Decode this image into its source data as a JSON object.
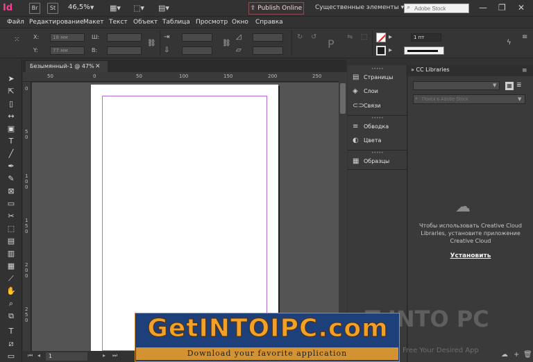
{
  "app": {
    "logo": "Id"
  },
  "titlebar": {
    "br_label": "Br",
    "st_label": "St",
    "zoom": "46,5%",
    "publish": "Publish Online",
    "workspace": "Существенные элементы",
    "stock_placeholder": "Adobe Stock"
  },
  "menu": [
    "Файл",
    "Редактирование",
    "Макет",
    "Текст",
    "Объект",
    "Таблица",
    "Просмотр",
    "Окно",
    "Справка"
  ],
  "control": {
    "x_label": "X:",
    "y_label": "Y:",
    "w_label": "Ш:",
    "h_label": "В:",
    "x_value": "18 мм",
    "y_value": "77 мм",
    "stroke_weight": "1 пт"
  },
  "document": {
    "tab_title": "Безымянный-1 @ 47%",
    "page_number": "1",
    "ruler_top": [
      "50",
      "0",
      "50",
      "100",
      "150",
      "200",
      "250"
    ],
    "ruler_left": [
      "0",
      "5",
      "0",
      "1",
      "0",
      "0",
      "1",
      "5",
      "0",
      "2",
      "0",
      "0",
      "2",
      "5",
      "0"
    ]
  },
  "panels": {
    "items": [
      {
        "label": "Страницы",
        "icon": "pages-icon"
      },
      {
        "label": "Слои",
        "icon": "layers-icon"
      },
      {
        "label": "Связи",
        "icon": "links-icon"
      },
      {
        "label": "Обводка",
        "icon": "stroke-icon"
      },
      {
        "label": "Цвета",
        "icon": "swatch-color-icon"
      },
      {
        "label": "Образцы",
        "icon": "swatches-icon"
      }
    ]
  },
  "cc_libraries": {
    "tab": "CC Libraries",
    "search_placeholder": "Поиск в Adobe Stock",
    "message": "Чтобы использовать Creative Cloud Libraries, установите приложение Creative Cloud",
    "install": "Установить"
  },
  "watermark": {
    "title": "GetINTOIPC.com",
    "subtitle": "Download your favorite application",
    "right_text": "T INTO PC",
    "right_sub": "Free Your Desired App"
  },
  "colors": {
    "accent": "#ff3c93",
    "guide": "#b56bd1",
    "banner_bg": "#1d3f7a",
    "banner_text": "#f0a12a"
  }
}
